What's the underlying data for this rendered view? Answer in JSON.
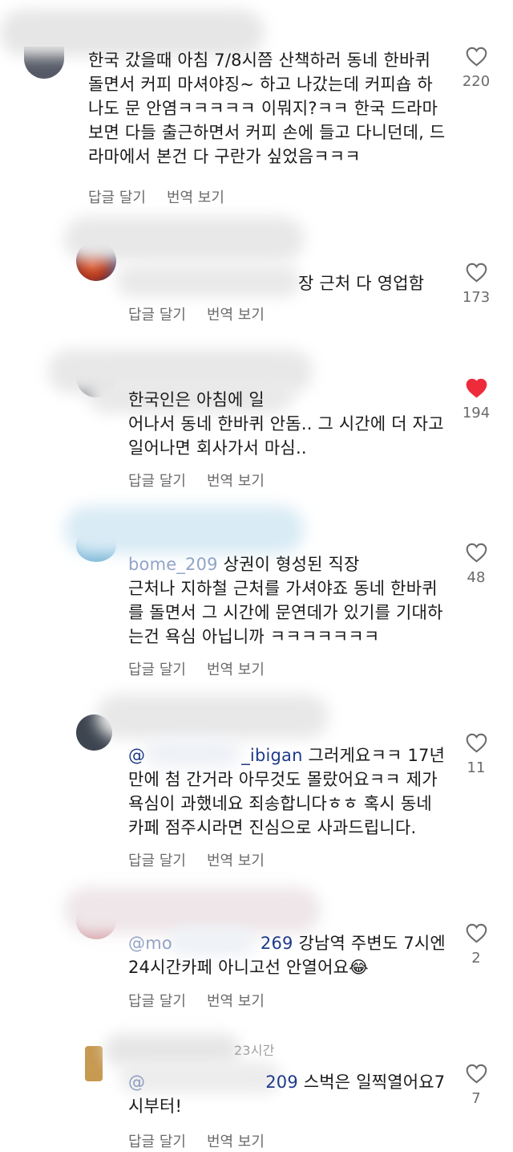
{
  "comments": [
    {
      "text": "한국 갔을때 아침 7/8시쯤 산책하러 동네 한바퀴\n돌면서 커피 마셔야징~ 하고 나갔는데 커피숍 하\n나도 문 안염ㅋㅋㅋㅋㅋ 이뭐지?ㅋㅋ 한국 드라마\n보면 다들 출근하면서 커피 손에 들고 다니던데, 드\n라마에서 본건 다 구란가 싶었음ㅋㅋㅋ",
      "likes": "220",
      "liked": false
    },
    {
      "text": "장 근처 다 영업함",
      "likes": "173",
      "liked": false
    },
    {
      "text": "한국인은 아침에 일\n어나서 동네 한바퀴 안돔.. 그 시간에 더 자고\n일어나면 회사가서 마심..",
      "likes": "194",
      "liked": true
    },
    {
      "mention": "bome_209",
      "text": " 상권이 형성된 직장\n근처나 지하철 근처를 가셔야죠 동네 한바퀴\n를 돌면서 그 시간에 문연데가 있기를 기대하\n는건 욕심 아닙니까 ㅋㅋㅋㅋㅋㅋㅋ",
      "likes": "48",
      "liked": false
    },
    {
      "mention": "@",
      "mention2": "_ibigan",
      "text": " 그러게요ㅋㅋ 17년\n만에 첨 간거라 아무것도 몰랐어요ㅋㅋ 제가\n욕심이 과했네요 죄송합니다ㅎㅎ 혹시 동네\n카페 점주시라면 진심으로 사과드립니다.",
      "likes": "11",
      "liked": false
    },
    {
      "mention": "@mo",
      "mention2": "269",
      "text": " 강남역 주변도 7시엔\n24시간카페 아니고선 안열어요😂",
      "likes": "2",
      "liked": false
    },
    {
      "header": "23시간",
      "mention": "@",
      "mention2": "209",
      "text": " 스벅은 일찍열어요7\n시부터!",
      "likes": "7",
      "liked": false
    }
  ],
  "actions": {
    "reply": "답글 달기",
    "translate": "번역 보기"
  },
  "colors": {
    "heart_filled": "#ed2b3a",
    "heart_outline": "#6b6b6b",
    "meta": "#6b6b6b"
  },
  "icons": {
    "like": "heart-icon"
  }
}
